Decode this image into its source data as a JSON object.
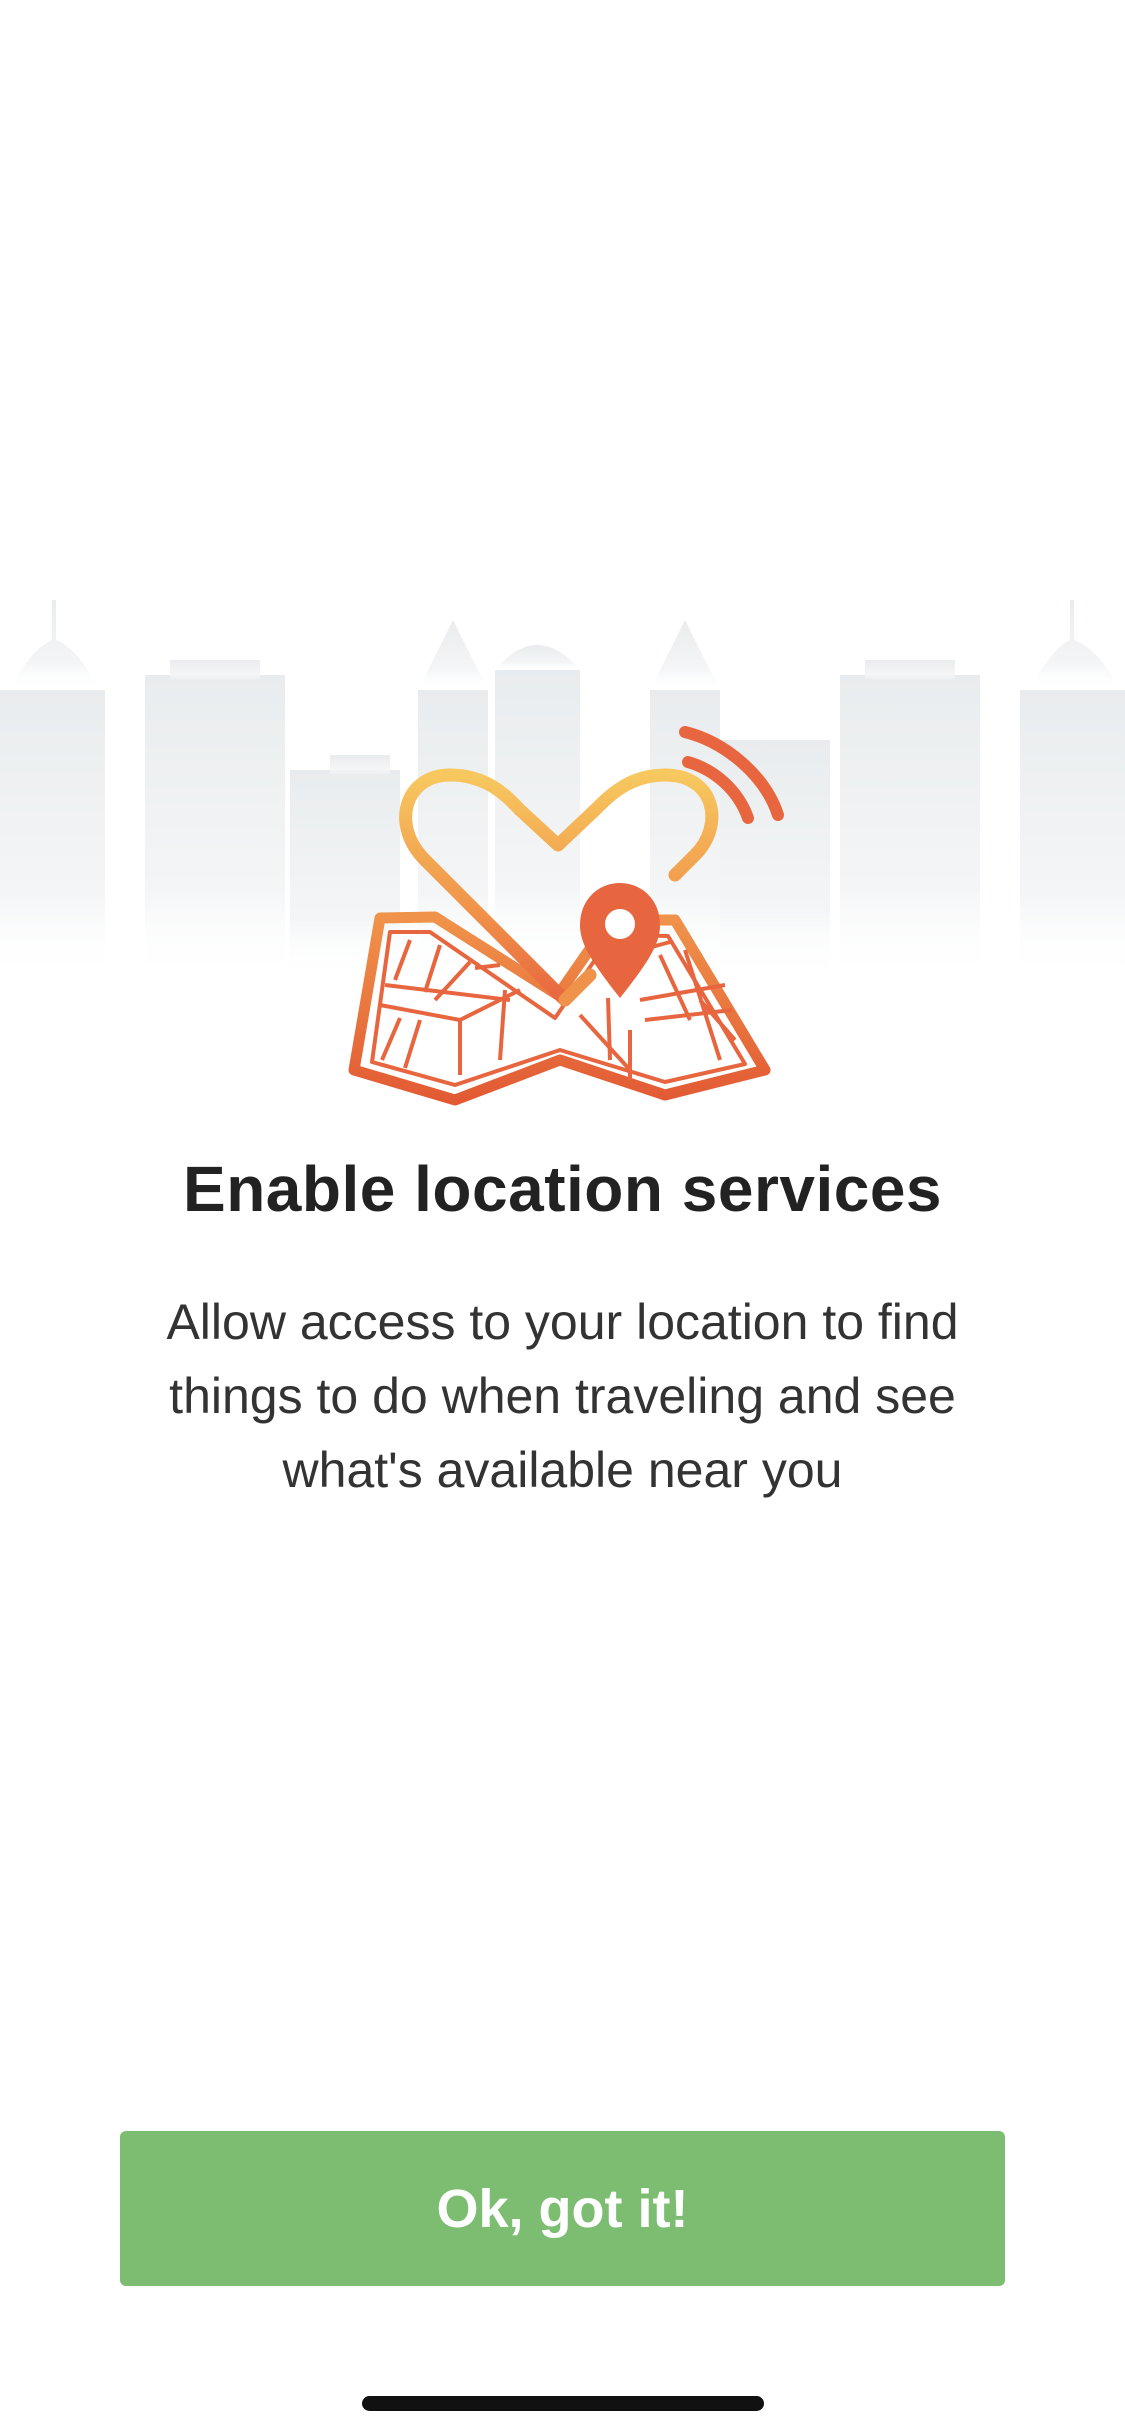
{
  "onboarding": {
    "title": "Enable location services",
    "description": "Allow access to your location to find things to do when traveling and see what's available near you",
    "primary_button_label": "Ok, got it!"
  },
  "illustration": {
    "icons": [
      "city-skyline-icon",
      "heart-map-icon",
      "location-pin-icon",
      "signal-waves-icon"
    ]
  },
  "colors": {
    "button_bg": "#7dbd72",
    "accent_orange": "#e8663f",
    "accent_yellow": "#f5c35e",
    "title_text": "#222222",
    "body_text": "#333333",
    "skyline": "#eceff0"
  }
}
